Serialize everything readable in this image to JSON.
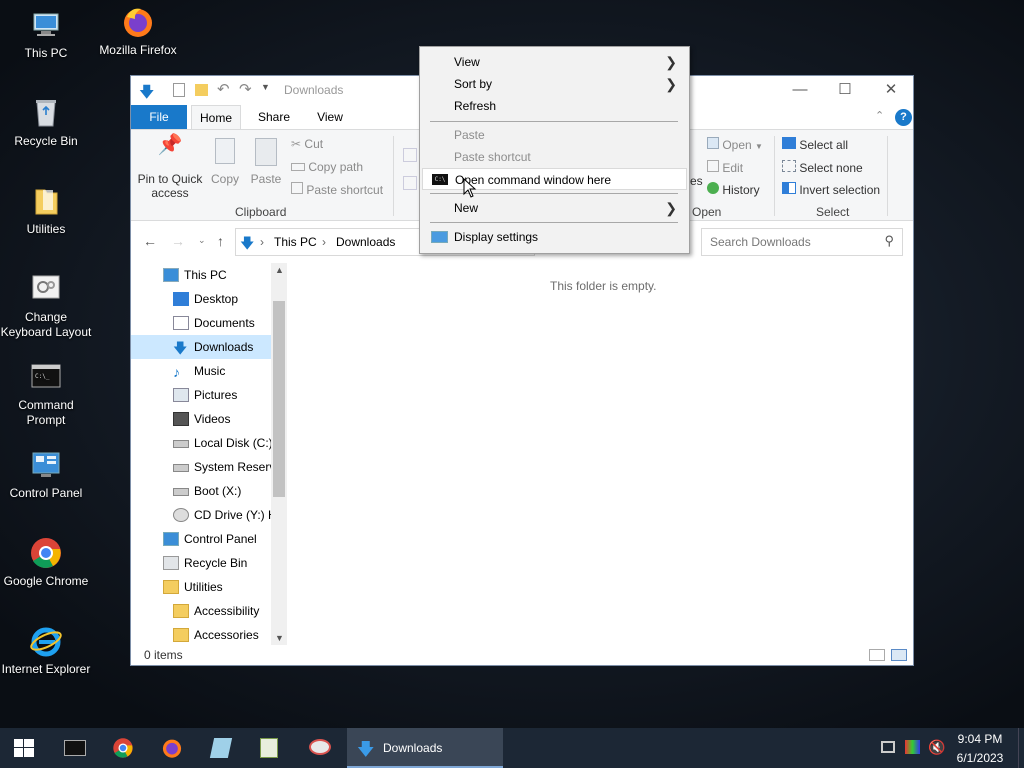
{
  "desktop": {
    "icons": [
      {
        "label": "This PC",
        "icon": "this-pc-icon"
      },
      {
        "label": "Mozilla Firefox",
        "icon": "firefox-icon"
      },
      {
        "label": "Recycle Bin",
        "icon": "recycle-bin-icon"
      },
      {
        "label": "Utilities",
        "icon": "folder-icon"
      },
      {
        "label": "Change Keyboard Layout",
        "icon": "keyboard-layout-icon"
      },
      {
        "label": "Command Prompt",
        "icon": "command-prompt-icon"
      },
      {
        "label": "Control Panel",
        "icon": "control-panel-icon"
      },
      {
        "label": "Google Chrome",
        "icon": "chrome-icon"
      },
      {
        "label": "Internet Explorer",
        "icon": "internet-explorer-icon"
      }
    ]
  },
  "explorer": {
    "title": "Downloads",
    "tabs": {
      "file": "File",
      "home": "Home",
      "share": "Share",
      "view": "View"
    },
    "ribbon": {
      "pin": "Pin to Quick access",
      "copy": "Copy",
      "paste": "Paste",
      "cut": "Cut",
      "copy_path": "Copy path",
      "paste_shortcut": "Paste shortcut",
      "clipboard_group": "Clipboard",
      "open": "Open",
      "edit": "Edit",
      "history": "History",
      "open_group": "Open",
      "properties_partial": "es",
      "select_all": "Select all",
      "select_none": "Select none",
      "invert_selection": "Invert selection",
      "select_group": "Select"
    },
    "address": {
      "path": [
        "This PC",
        "Downloads"
      ],
      "search_placeholder": "Search Downloads"
    },
    "nav_items": [
      {
        "label": "This PC",
        "icon": "this-pc-icon",
        "level": 0
      },
      {
        "label": "Desktop",
        "icon": "desktop-icon",
        "level": 1
      },
      {
        "label": "Documents",
        "icon": "documents-icon",
        "level": 1
      },
      {
        "label": "Downloads",
        "icon": "downloads-icon",
        "level": 1,
        "selected": true
      },
      {
        "label": "Music",
        "icon": "music-icon",
        "level": 1
      },
      {
        "label": "Pictures",
        "icon": "pictures-icon",
        "level": 1
      },
      {
        "label": "Videos",
        "icon": "videos-icon",
        "level": 1
      },
      {
        "label": "Local Disk (C:)",
        "icon": "drive-icon",
        "level": 1
      },
      {
        "label": "System Reserve",
        "icon": "drive-icon",
        "level": 1
      },
      {
        "label": "Boot (X:)",
        "icon": "drive-icon",
        "level": 1
      },
      {
        "label": "CD Drive (Y:) H",
        "icon": "cd-drive-icon",
        "level": 1
      },
      {
        "label": "Control Panel",
        "icon": "control-panel-icon",
        "level": 0
      },
      {
        "label": "Recycle Bin",
        "icon": "recycle-bin-icon",
        "level": 0
      },
      {
        "label": "Utilities",
        "icon": "folder-icon",
        "level": 0
      },
      {
        "label": "Accessibility",
        "icon": "folder-icon",
        "level": 1
      },
      {
        "label": "Accessories",
        "icon": "folder-icon",
        "level": 1
      }
    ],
    "empty_message": "This folder is empty.",
    "status": "0 items"
  },
  "context_menu": {
    "view": "View",
    "sort_by": "Sort by",
    "refresh": "Refresh",
    "paste": "Paste",
    "paste_shortcut": "Paste shortcut",
    "open_cmd": "Open command window here",
    "new": "New",
    "display_settings": "Display settings"
  },
  "taskbar": {
    "downloads_label": "Downloads",
    "time": "9:04 PM",
    "date": "6/1/2023"
  },
  "colors": {
    "accent": "#1979ca",
    "selection": "#cce8ff",
    "taskbar": "#1c2735"
  }
}
